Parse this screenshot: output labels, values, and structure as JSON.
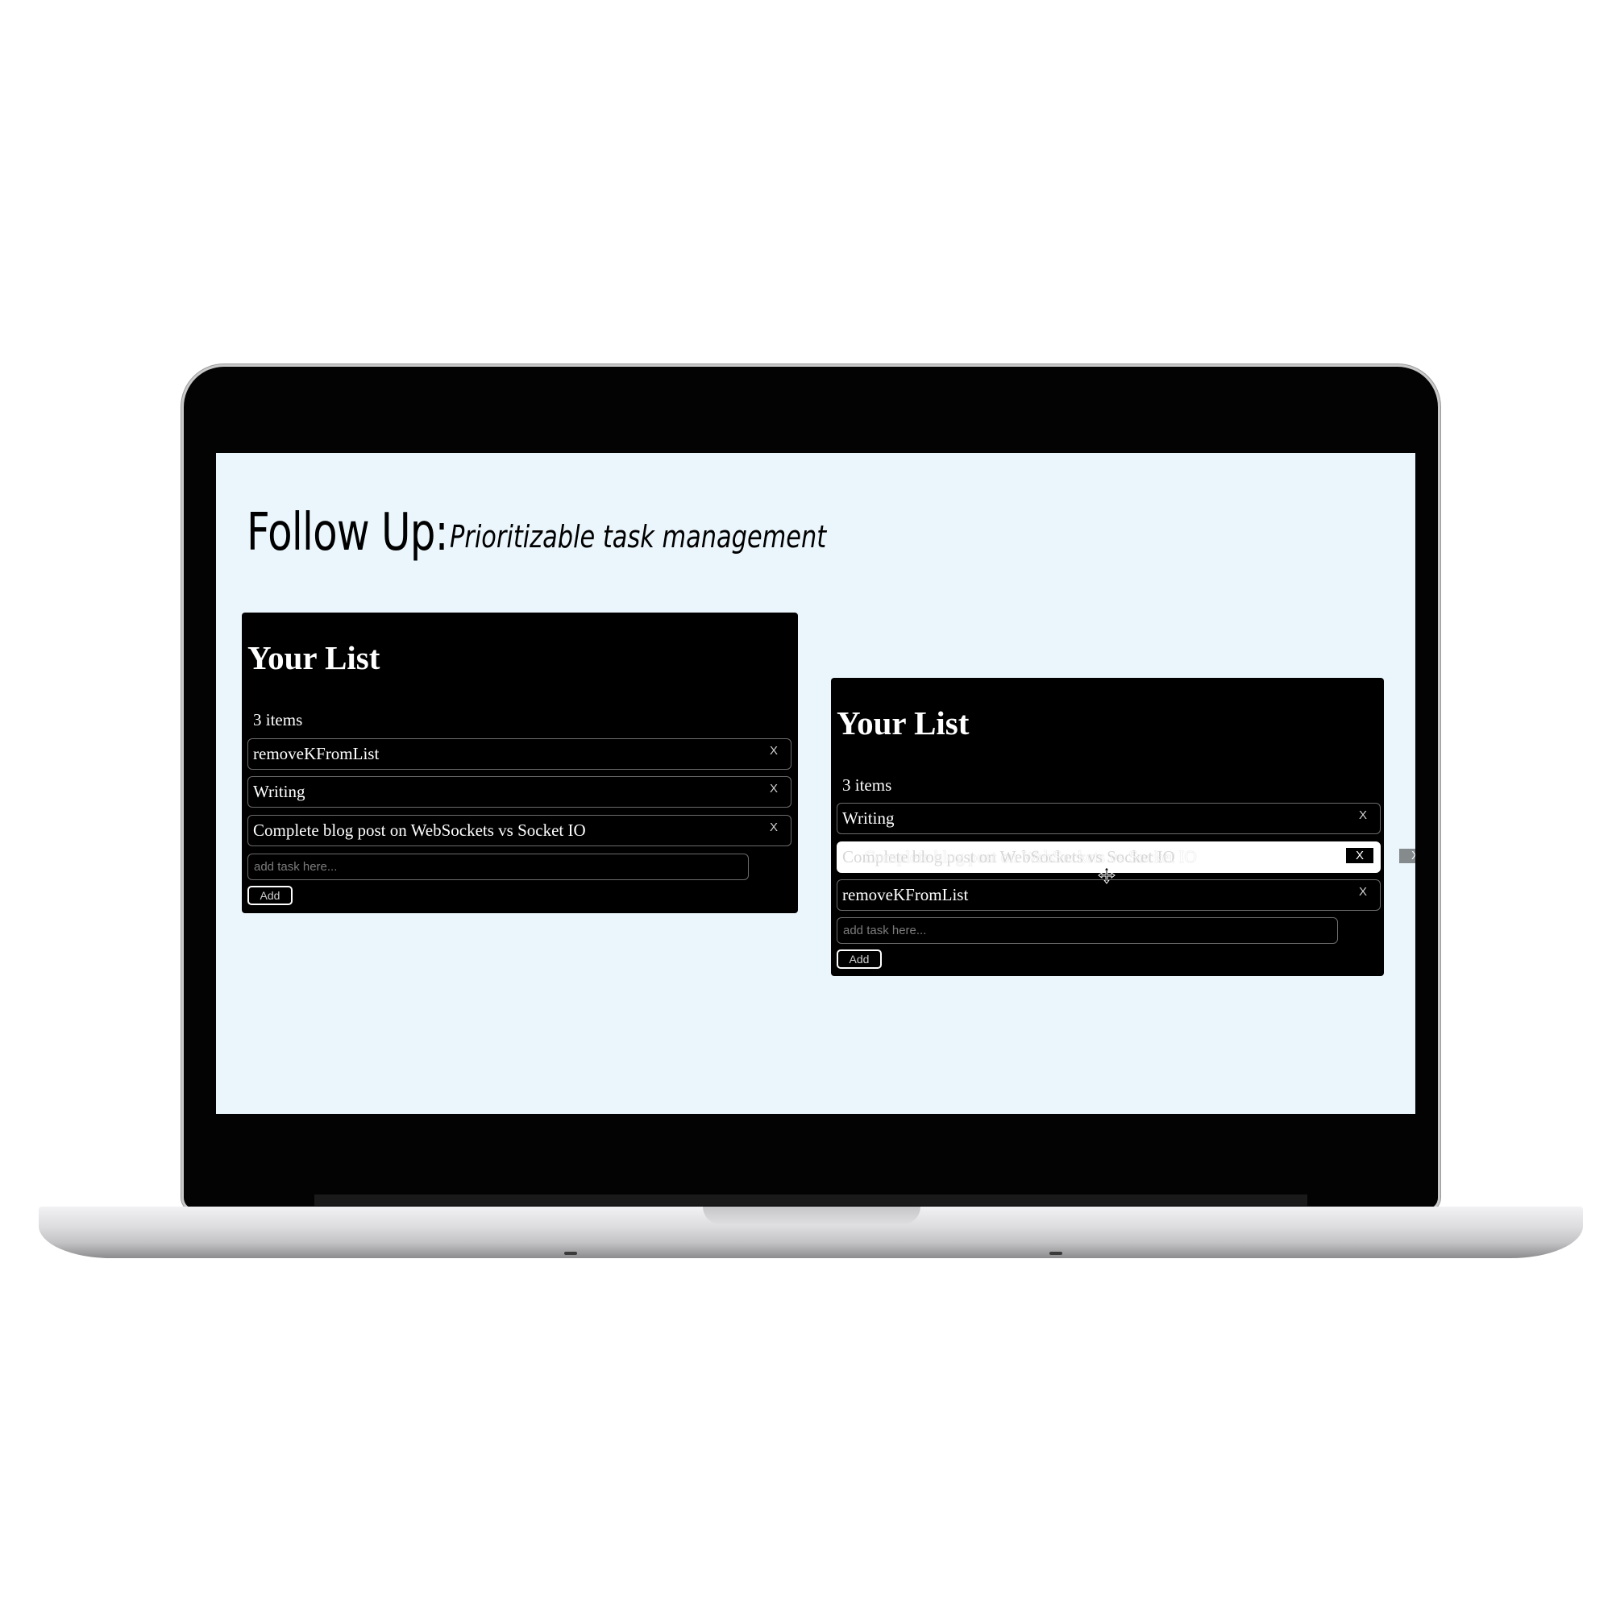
{
  "app": {
    "title": "Follow Up:",
    "subtitle": "Prioritizable task management"
  },
  "left_panel": {
    "heading": "Your List",
    "count": "3 items",
    "items": [
      {
        "label": "removeKFromList",
        "remove": "X"
      },
      {
        "label": "Writing",
        "remove": "X"
      },
      {
        "label": "Complete blog post on WebSockets vs Socket IO",
        "remove": "X"
      }
    ],
    "input_placeholder": "add task here...",
    "add_label": "Add"
  },
  "right_panel": {
    "heading": "Your List",
    "count": "3 items",
    "items": [
      {
        "label": "Writing",
        "remove": "X"
      },
      {
        "label": "Complete blog post on WebSockets vs Socket IO",
        "remove": "X",
        "state": "dragging"
      },
      {
        "label": "removeKFromList",
        "remove": "X"
      }
    ],
    "drag_preview_label": "Complete blog post on WebSockets vs Socket IO",
    "drag_preview_remove": "X",
    "input_placeholder": "add task here...",
    "add_label": "Add"
  },
  "colors": {
    "page_background": "#ebf6fc",
    "panel_background": "#000000",
    "text": "#ffffff",
    "laptop_bezel": "#030303"
  }
}
